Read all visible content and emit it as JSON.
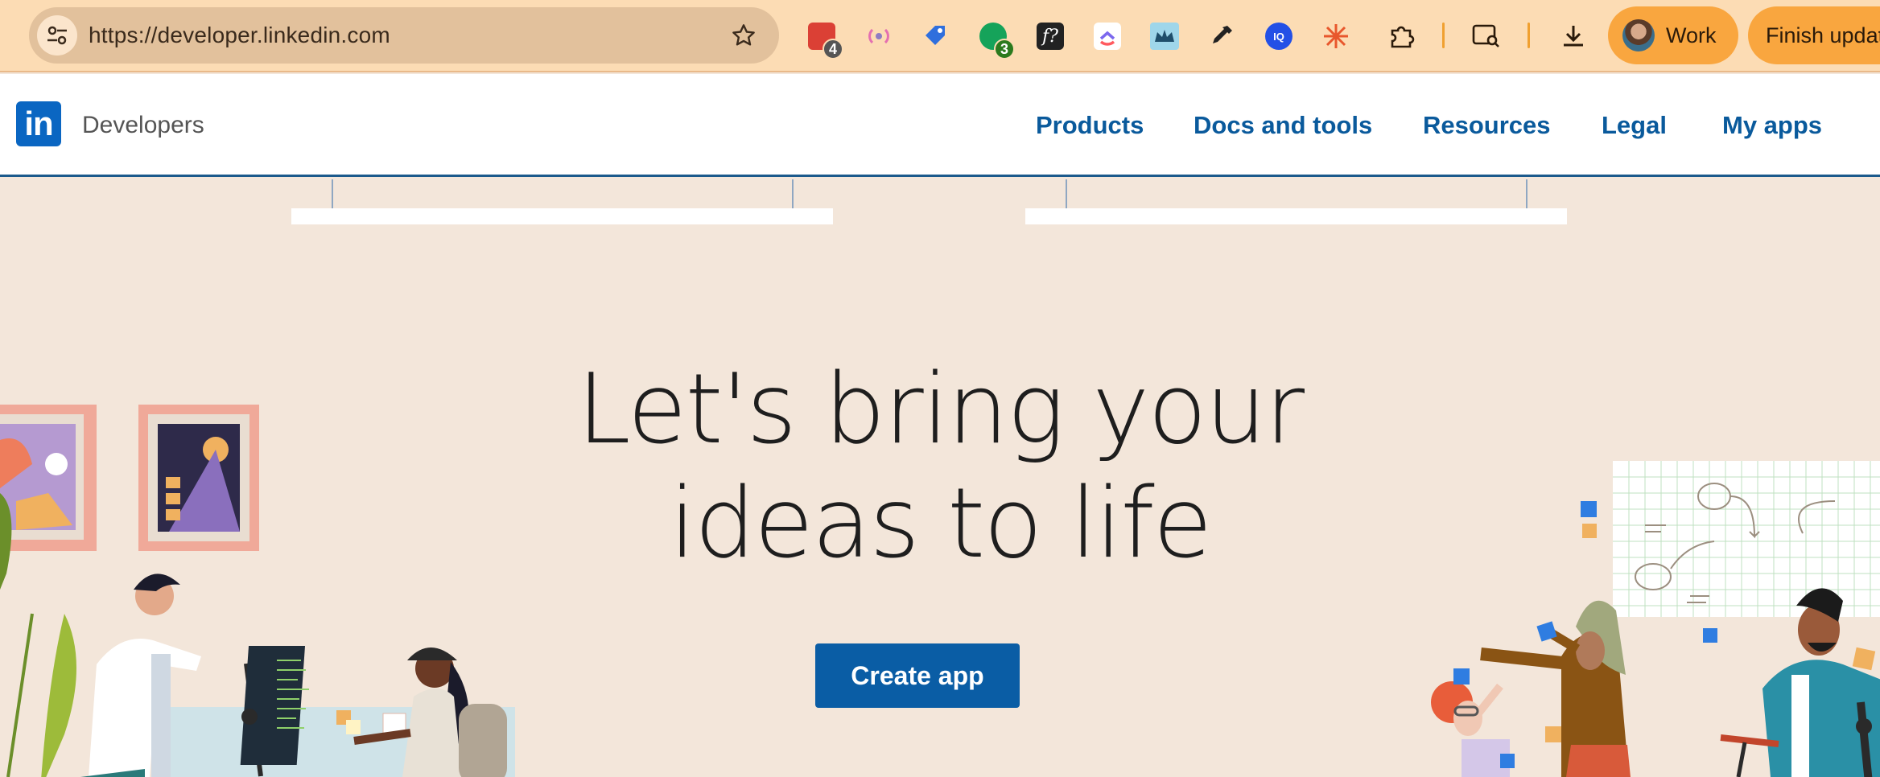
{
  "browser": {
    "url": "https://developer.linkedin.com",
    "extensions": [
      {
        "name": "todoist-extension",
        "badge": "4",
        "color": "#db4035"
      },
      {
        "name": "broadcast-extension",
        "badge": "",
        "color": "#8e7cc3"
      },
      {
        "name": "tag-extension",
        "badge": "",
        "color": "#2f6fdd"
      },
      {
        "name": "grammarly-extension",
        "badge": "3",
        "color": "#15a35a"
      },
      {
        "name": "font-finder-extension",
        "badge": "",
        "color": "#222222"
      },
      {
        "name": "clickup-extension",
        "badge": "",
        "color": "#7b68ee"
      },
      {
        "name": "crown-extension",
        "badge": "",
        "color": "#2a9fd6"
      },
      {
        "name": "eyedropper-extension",
        "badge": "",
        "color": "#222222"
      },
      {
        "name": "iq-extension",
        "badge": "",
        "color": "#2350e6"
      },
      {
        "name": "starburst-extension",
        "badge": "",
        "color": "#e8572c"
      }
    ],
    "profile_label": "Work",
    "update_label": "Finish update"
  },
  "header": {
    "brand": "Developers",
    "nav": [
      {
        "label": "Products"
      },
      {
        "label": "Docs and tools"
      },
      {
        "label": "Resources"
      },
      {
        "label": "Legal"
      },
      {
        "label": "My apps"
      }
    ]
  },
  "hero": {
    "headline_line1": "Let's bring your",
    "headline_line2": "ideas to life",
    "cta_label": "Create app"
  }
}
